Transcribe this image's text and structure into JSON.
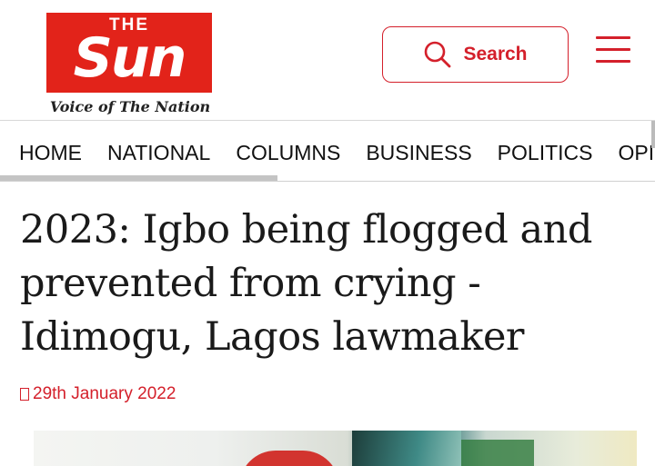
{
  "header": {
    "logo": {
      "top_text": "THE",
      "main_text": "Sun",
      "tagline": "Voice of The Nation",
      "brand_color": "#e2231a"
    },
    "search": {
      "label": "Search",
      "icon": "search-icon"
    },
    "menu": {
      "icon": "hamburger-menu-icon"
    },
    "accent_color": "#d4202b"
  },
  "nav": {
    "items": [
      "HOME",
      "NATIONAL",
      "COLUMNS",
      "BUSINESS",
      "POLITICS",
      "OPI"
    ]
  },
  "article": {
    "headline": "2023: Igbo being flogged and prevented from crying - Idimogu, Lagos lawmaker",
    "date_icon": "",
    "date": "29th January 2022"
  }
}
